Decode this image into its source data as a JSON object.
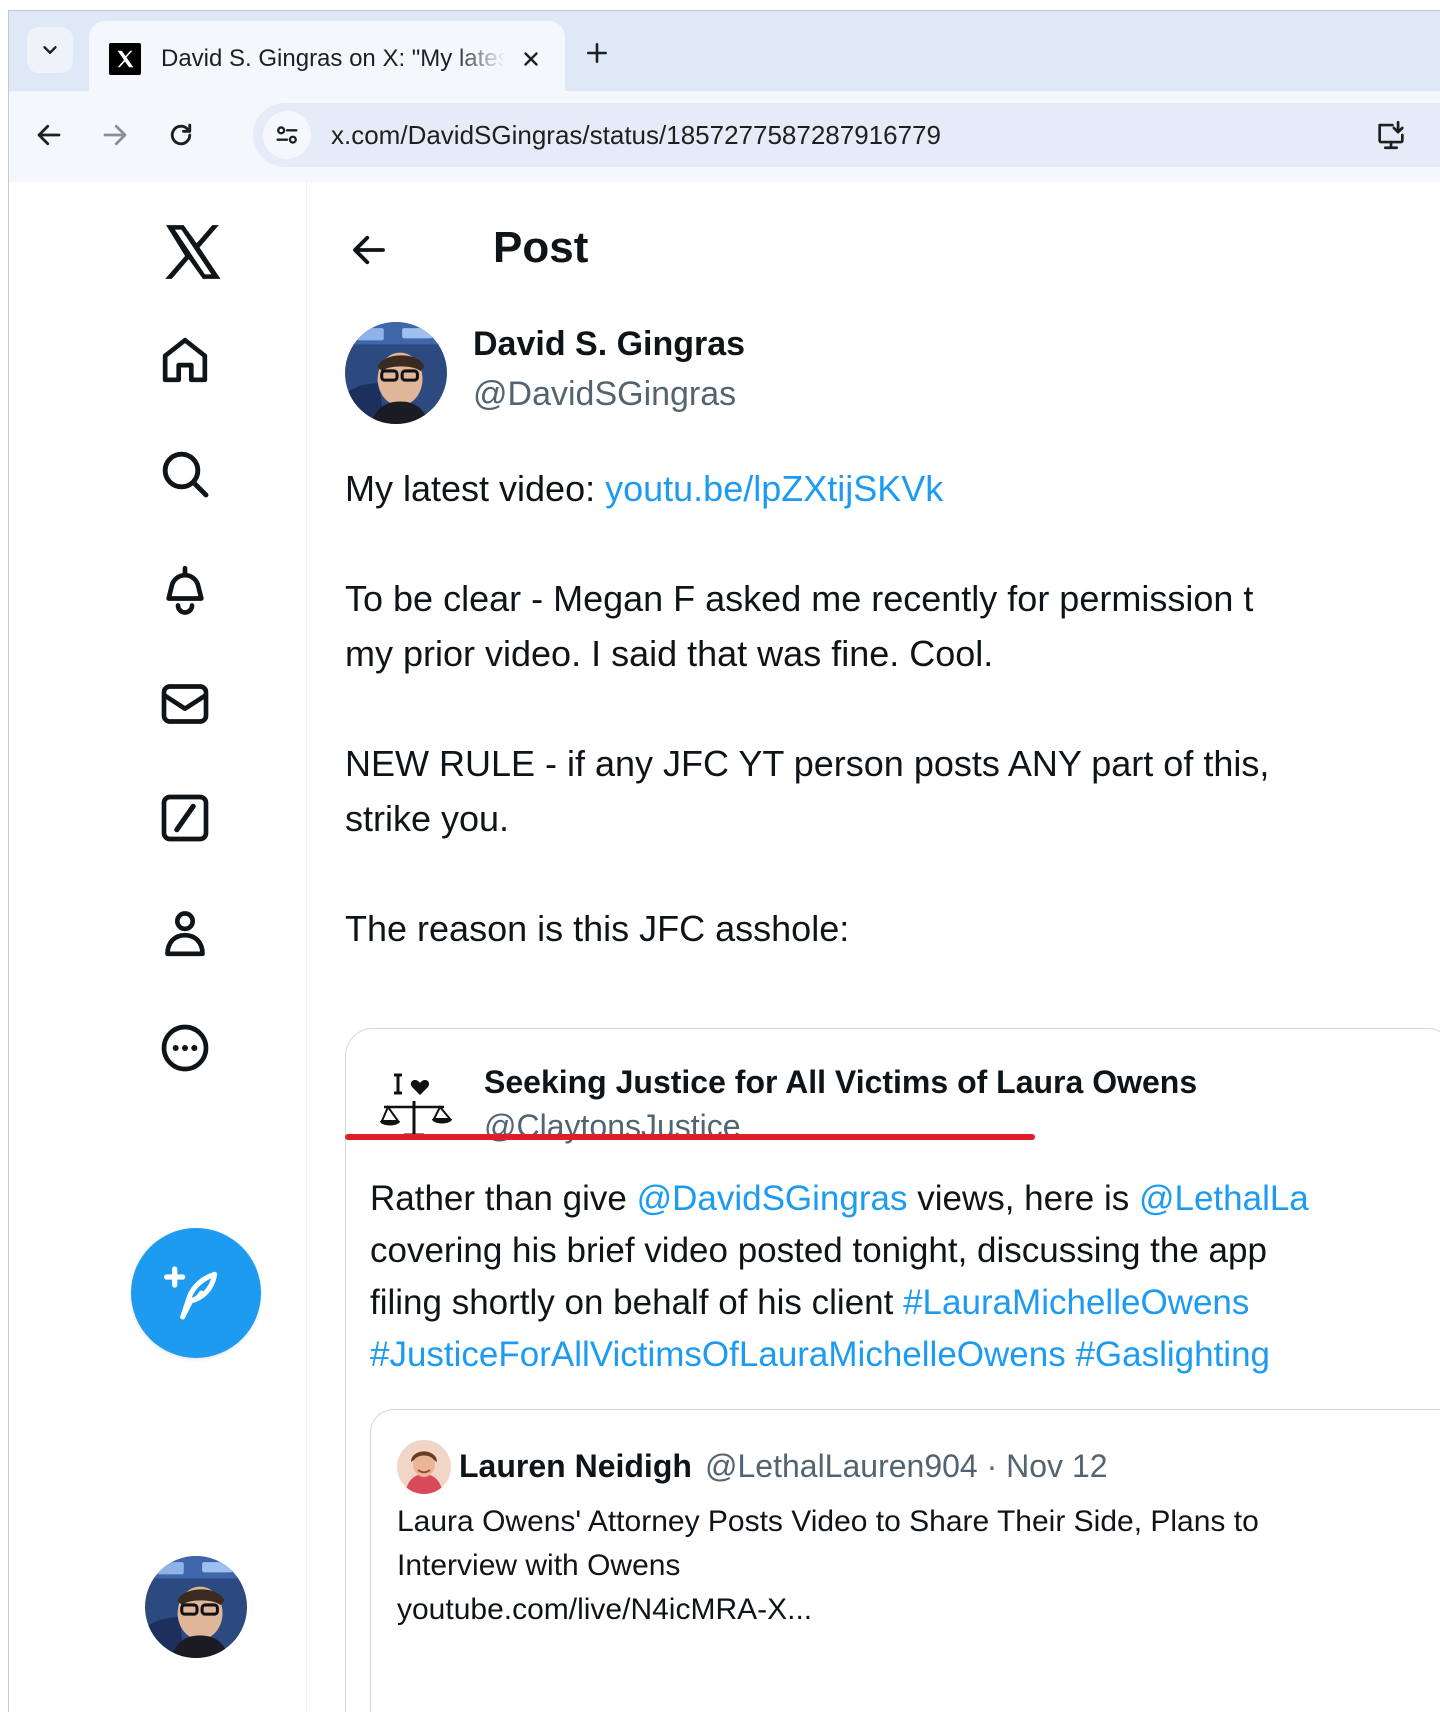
{
  "browser": {
    "tab_title": "David S. Gingras on X: \"My latest video: youtu.be/lpZXtijSKVk\"",
    "url": "x.com/DavidSGingras/status/1857277587287916779"
  },
  "header": {
    "title": "Post"
  },
  "post": {
    "author_name": "David S. Gingras",
    "author_handle": "@DavidSGingras",
    "line1_prefix": "My latest video: ",
    "line1_link": "youtu.be/lpZXtijSKVk",
    "para2_line1": "To be clear - Megan F asked me recently for permission t",
    "para2_line2": "my prior video. I said that was fine.  Cool.",
    "para3_line1": "NEW RULE - if any JFC YT person posts ANY part of this,",
    "para3_line2": "strike you.",
    "para4": "The reason is this JFC asshole:"
  },
  "quote": {
    "name": "Seeking Justice for All Victims of Laura Owens",
    "handle": "@ClaytonsJustice",
    "line1_a": "Rather than give ",
    "line1_link1": "@DavidSGingras",
    "line1_b": " views, here is ",
    "line1_link2": "@LethalLa",
    "line2": "covering his brief video posted tonight, discussing the app",
    "line3_a": "filing shortly on behalf of his client ",
    "line3_link": "#LauraMichelleOwens",
    "line4_link1": "#JusticeForAllVictimsOfLauraMichelleOwens",
    "line4_link2": " #Gaslighting"
  },
  "inner_quote": {
    "name": "Lauren Neidigh",
    "meta": "@LethalLauren904 · Nov 12",
    "line1": "Laura Owens' Attorney Posts Video to Share Their Side, Plans to",
    "line2": "Interview with Owens",
    "line3": "youtube.com/live/N4icMRA-X..."
  },
  "colors": {
    "accent": "#1d9bf0",
    "highlight_underline": "#e11d2a"
  },
  "icons": {
    "sidebar": [
      "x-logo-icon",
      "home-icon",
      "search-icon",
      "bell-icon",
      "mail-icon",
      "grok-icon",
      "profile-icon",
      "more-icon",
      "compose-icon"
    ]
  }
}
